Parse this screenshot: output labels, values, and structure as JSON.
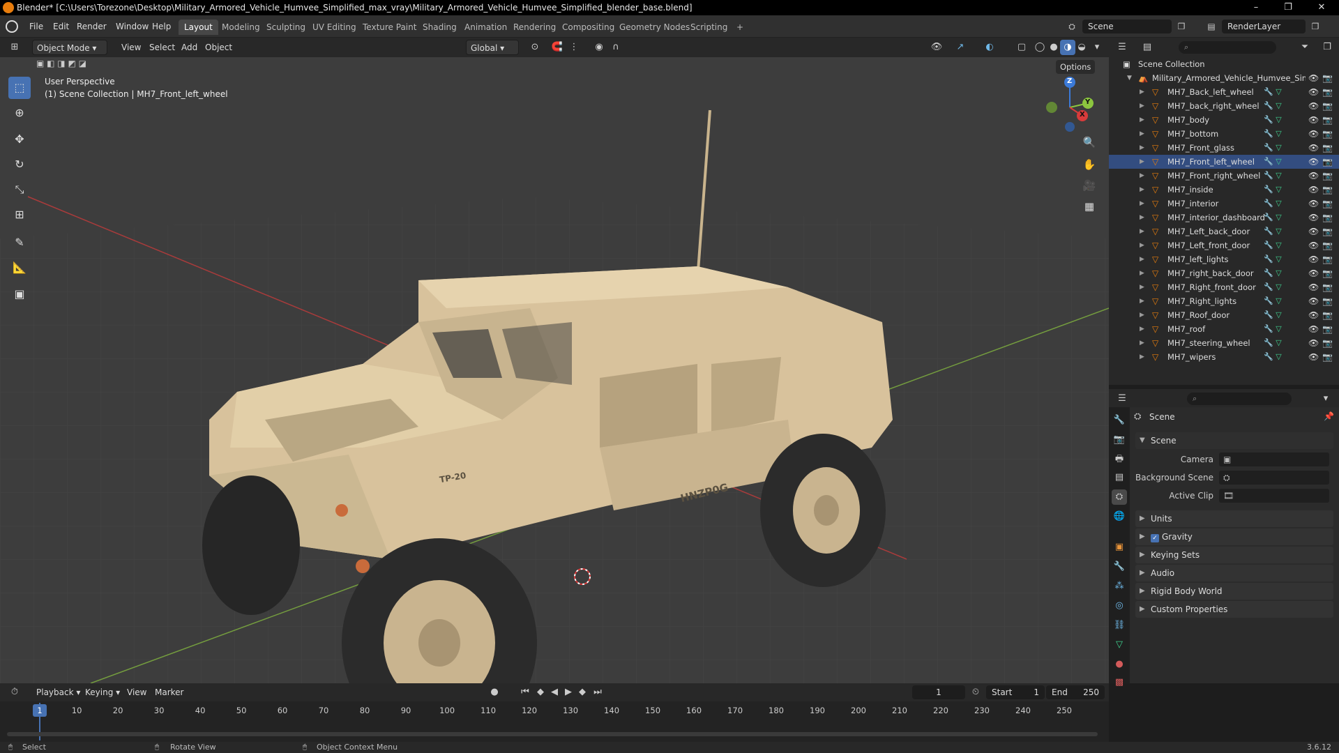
{
  "titlebar": {
    "title": "Blender* [C:\\Users\\Torezone\\Desktop\\Military_Armored_Vehicle_Humvee_Simplified_max_vray\\Military_Armored_Vehicle_Humvee_Simplified_blender_base.blend]",
    "minimize": "–",
    "restore": "❐",
    "close": "✕"
  },
  "menubar": {
    "items": [
      "File",
      "Edit",
      "Render",
      "Window",
      "Help"
    ],
    "workspaces": [
      "Layout",
      "Modeling",
      "Sculpting",
      "UV Editing",
      "Texture Paint",
      "Shading",
      "Animation",
      "Rendering",
      "Compositing",
      "Geometry Nodes",
      "Scripting"
    ],
    "active_workspace": "Layout",
    "add_tab": "+",
    "scene_name": "Scene",
    "view_layer": "RenderLayer"
  },
  "viewport_header": {
    "mode": "Object Mode",
    "menus": [
      "View",
      "Select",
      "Add",
      "Object"
    ],
    "orientation": "Global",
    "options": "Options"
  },
  "viewport": {
    "perspective": "User Perspective",
    "context": "(1) Scene Collection | MH7_Front_left_wheel",
    "hood_text": "TP-20",
    "door_text": "HNZP0G",
    "gizmo": {
      "x": "X",
      "y": "Y",
      "z": "Z"
    },
    "colors": {
      "x_axis": "#d83b3b",
      "y_axis": "#8cc63f",
      "z_axis": "#3b7ad8",
      "vehicle": "#d8c29c"
    }
  },
  "outliner": {
    "root": "Scene Collection",
    "collection": "Military_Armored_Vehicle_Humvee_Sim",
    "selected": "MH7_Front_left_wheel",
    "objects": [
      "MH7_Back_left_wheel",
      "MH7_back_right_wheel",
      "MH7_body",
      "MH7_bottom",
      "MH7_Front_glass",
      "MH7_Front_left_wheel",
      "MH7_Front_right_wheel",
      "MH7_inside",
      "MH7_interior",
      "MH7_interior_dashboard",
      "MH7_Left_back_door",
      "MH7_Left_front_door",
      "MH7_left_lights",
      "MH7_right_back_door",
      "MH7_Right_front_door",
      "MH7_Right_lights",
      "MH7_Roof_door",
      "MH7_roof",
      "MH7_steering_wheel",
      "MH7_wipers"
    ]
  },
  "properties": {
    "header": "Scene",
    "panel": "Scene",
    "fields": [
      {
        "label": "Camera",
        "value": ""
      },
      {
        "label": "Background Scene",
        "value": ""
      },
      {
        "label": "Active Clip",
        "value": ""
      }
    ],
    "sections": [
      "Units",
      "Gravity",
      "Keying Sets",
      "Audio",
      "Rigid Body World",
      "Custom Properties"
    ],
    "gravity_checked": true
  },
  "timeline": {
    "menus": [
      "Playback",
      "Keying",
      "View",
      "Marker"
    ],
    "current_frame": "1",
    "start_label": "Start",
    "start": "1",
    "end_label": "End",
    "end": "250",
    "ticks": [
      "1",
      "10",
      "20",
      "30",
      "40",
      "50",
      "60",
      "70",
      "80",
      "90",
      "100",
      "110",
      "120",
      "130",
      "140",
      "150",
      "160",
      "170",
      "180",
      "190",
      "200",
      "210",
      "220",
      "230",
      "240",
      "250"
    ]
  },
  "statusbar": {
    "select": "Select",
    "rotate": "Rotate View",
    "context_menu": "Object Context Menu",
    "version": "3.6.12"
  }
}
